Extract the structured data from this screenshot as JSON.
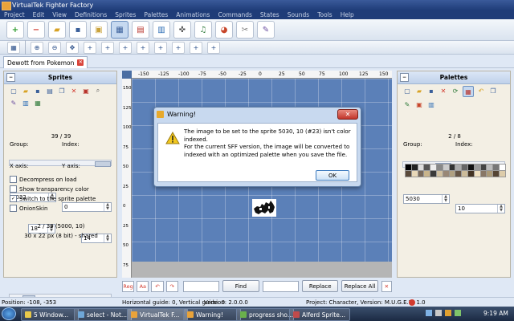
{
  "app": {
    "title": "VirtualTek Fighter Factory"
  },
  "menu": [
    "Project",
    "Edit",
    "View",
    "Definitions",
    "Sprites",
    "Palettes",
    "Animations",
    "Commands",
    "States",
    "Sounds",
    "Tools",
    "Help"
  ],
  "toolbar": {
    "row1": [
      "new-icon",
      "close-icon",
      "open-icon",
      "save-icon",
      "lock-icon",
      "sprite-editor-icon",
      "animation-editor-icon",
      "state-editor-icon",
      "command-editor-icon",
      "sound-editor-icon",
      "palette-editor-icon",
      "tools-icon",
      "options-icon"
    ],
    "row2": [
      "axis-icon",
      "zoom-in-icon",
      "zoom-out-icon",
      "move-icon",
      "align-tl-icon",
      "align-t-icon",
      "align-tr-icon",
      "align-l-icon",
      "align-r-icon",
      "align-bl-icon",
      "align-b-icon",
      "align-br-icon"
    ]
  },
  "tab": {
    "label": "Dewott from Pokemon"
  },
  "sprites": {
    "title": "Sprites",
    "counter": "39 / 39",
    "group_label": "Group:",
    "index_label": "Index:",
    "group_value": "5032",
    "index_value": "0",
    "xaxis_label": "X axis:",
    "xaxis_value": "18",
    "yaxis_label": "Y axis:",
    "yaxis_value": "14",
    "checkboxes": [
      {
        "label": "Decompress on load",
        "checked": false
      },
      {
        "label": "Show transparency color",
        "checked": false
      },
      {
        "label": "Switch to the sprite palette",
        "checked": true
      },
      {
        "label": "OnionSkin",
        "checked": false
      }
    ],
    "info1": "2 / 39 (5000, 10)",
    "info2": "30 x 22 px (8 bit) - shared"
  },
  "palettes": {
    "title": "Palettes",
    "counter": "2 / 8",
    "group_label": "Group:",
    "index_label": "Index:",
    "group_value": "5030",
    "index_value": "10"
  },
  "ruler": {
    "h": [
      "-150",
      "-125",
      "-100",
      "-75",
      "-50",
      "-25",
      "0",
      "25",
      "50",
      "75",
      "100",
      "125",
      "150"
    ],
    "v": [
      "150",
      "125",
      "100",
      "75",
      "50",
      "25",
      "0",
      "25",
      "50",
      "75"
    ]
  },
  "search": {
    "regex_label": "Reg",
    "case_label": "Aa",
    "find_label": "Find",
    "replace_label": "Replace",
    "replace_all_label": "Replace All",
    "find_value": "",
    "replace_value": ""
  },
  "status": {
    "position": "Position: -108, -353",
    "guides": "Horizontal guide: 0, Vertical guide: 0",
    "version": "Version: 2.0.0.0",
    "project": "Project: Character, Version: M.U.G.E.N. 1.0"
  },
  "dialog": {
    "title": "Warning!",
    "close_label": "✕",
    "lines": [
      "The image to be set to the sprite 5030, 10 (#23) isn't color",
      "indexed.",
      "For the current SFF version, the image will be converted to",
      "indexed with an optimized palette when you save the file."
    ],
    "ok_label": "OK"
  },
  "taskbar": {
    "items": [
      {
        "label": "5 Window...",
        "color": "#e8c84a"
      },
      {
        "label": "select - Not...",
        "color": "#6fa7d8"
      },
      {
        "label": "VirtualTek F...",
        "color": "#e9a33a",
        "active": true
      },
      {
        "label": "Warning!",
        "color": "#e9a33a"
      },
      {
        "label": "progress sho...",
        "color": "#6ab04c"
      },
      {
        "label": "Alferd Sprite...",
        "color": "#c04b4b"
      }
    ],
    "time": "9:19 AM"
  },
  "colors": {
    "accent": "#1f3c78",
    "canvas": "#5b80b8",
    "panel": "#f3efe4"
  }
}
